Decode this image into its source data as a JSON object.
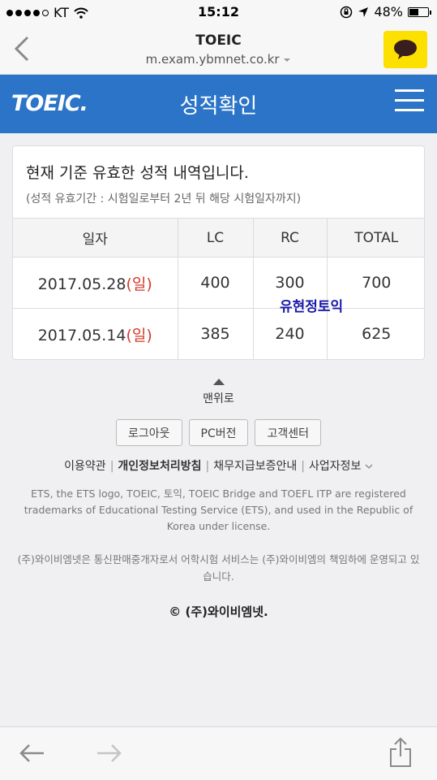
{
  "status_bar": {
    "carrier": "KT",
    "time": "15:12",
    "battery": "48%",
    "battery_level": 0.48
  },
  "browser": {
    "title": "TOEIC",
    "url": "m.exam.ybmnet.co.kr"
  },
  "header": {
    "logo": "TOEIC.",
    "title": "성적확인"
  },
  "card": {
    "heading": "현재 기준 유효한 성적 내역입니다.",
    "note": "(성적 유효기간 : 시험일로부터 2년 뒤 해당 시험일자까지)",
    "columns": [
      "일자",
      "LC",
      "RC",
      "TOTAL"
    ],
    "rows": [
      {
        "date": "2017.05.28",
        "day": "(일)",
        "lc": "400",
        "rc": "300",
        "total": "700"
      },
      {
        "date": "2017.05.14",
        "day": "(일)",
        "lc": "385",
        "rc": "240",
        "total": "625"
      }
    ],
    "watermark": "유현정토익"
  },
  "footer": {
    "to_top": "맨위로",
    "buttons": [
      "로그아웃",
      "PC버전",
      "고객센터"
    ],
    "links": [
      "이용약관",
      "개인정보처리방침",
      "채무지급보증안내",
      "사업자정보"
    ],
    "trademark": "ETS, the ETS logo, TOEIC, 토익, TOEIC Bridge and TOEFL ITP are registered trademarks of Educational Testing Service (ETS), and used in the Republic of Korea under license.",
    "company_note": "(주)와이비엠넷은 통신판매중개자로서 어학시험 서비스는 (주)와이비엠의 책임하에 운영되고 있습니다.",
    "copyright": "© (주)와이비엠넷."
  },
  "colors": {
    "header_blue": "#2b74c7",
    "kakao_yellow": "#fce000",
    "sunday_red": "#d23a2a"
  }
}
